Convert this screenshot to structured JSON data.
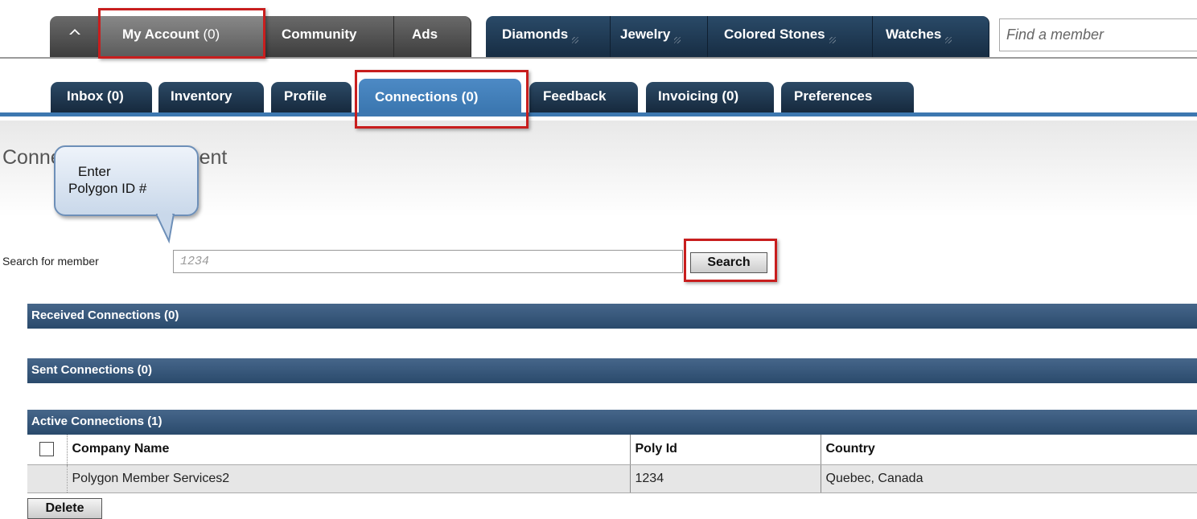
{
  "top_nav": {
    "home_icon": "home-icon",
    "my_account": {
      "label": "My Account",
      "count": " (0)"
    },
    "community": "Community",
    "ads": "Ads",
    "diamonds": "Diamonds",
    "jewelry": "Jewelry",
    "colored_stones": "Colored Stones",
    "watches": "Watches",
    "find_member_placeholder": "Find a member"
  },
  "sub_nav": {
    "tabs": [
      "Inbox (0)",
      "Inventory",
      "Profile",
      "Connections (0)",
      "Feedback",
      "Invoicing (0)",
      "Preferences"
    ],
    "active": "Connections (0)"
  },
  "page": {
    "title": "Connection Management",
    "callout": {
      "line1": "Enter",
      "line2": "Polygon ID #"
    }
  },
  "search": {
    "label": "Search for member",
    "value": "1234",
    "button": "Search"
  },
  "sections": {
    "received": "Received Connections (0)",
    "sent": "Sent Connections (0)",
    "active": "Active Connections (1)"
  },
  "table": {
    "headers": [
      "Company Name",
      "Poly Id",
      "Country"
    ],
    "rows": [
      [
        "Polygon Member Services2",
        "1234",
        "Quebec,  Canada"
      ]
    ]
  },
  "delete_button": "Delete",
  "colors": {
    "highlight_red": "#c81e1e",
    "nav_blue": "#172d43",
    "active_tab_blue": "#3874ad",
    "section_bar": "#2a4a6c"
  }
}
